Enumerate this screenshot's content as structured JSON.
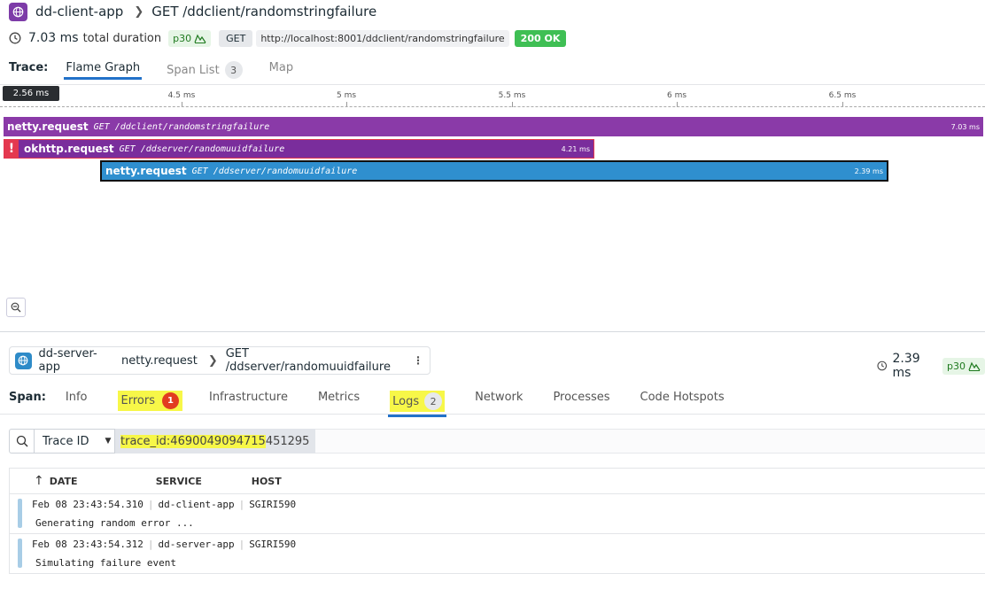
{
  "header": {
    "app_name": "dd-client-app",
    "route": "GET /ddclient/randomstringfailure",
    "duration": "7.03 ms",
    "duration_label": "total duration",
    "percentile": "p30",
    "method": "GET",
    "url": "http://localhost:8001/ddclient/randomstringfailure",
    "status": "200 OK"
  },
  "trace_tabs": {
    "label": "Trace:",
    "items": [
      {
        "label": "Flame Graph"
      },
      {
        "label": "Span List",
        "count": "3"
      },
      {
        "label": "Map"
      }
    ]
  },
  "ruler": {
    "cursor": "2.56 ms",
    "ticks": [
      "4.5 ms",
      "5 ms",
      "5.5 ms",
      "6 ms",
      "6.5 ms"
    ]
  },
  "spans": [
    {
      "name": "netty.request",
      "resource": "GET /ddclient/randomstringfailure",
      "duration": "7.03 ms",
      "color": "#8a3aa8"
    },
    {
      "name": "okhttp.request",
      "resource": "GET /ddserver/randomuuidfailure",
      "duration": "4.21 ms",
      "color": "#7a2d9c",
      "error": "!"
    },
    {
      "name": "netty.request",
      "resource": "GET /ddserver/randomuuidfailure",
      "duration": "2.39 ms",
      "color": "#2f8fcf"
    }
  ],
  "span_panel": {
    "service": "dd-server-app",
    "operation": "netty.request",
    "resource": "GET /ddserver/randomuuidfailure",
    "duration": "2.39 ms",
    "percentile": "p30"
  },
  "span_tabs": {
    "label": "Span:",
    "items": [
      {
        "label": "Info"
      },
      {
        "label": "Errors",
        "count": "1"
      },
      {
        "label": "Infrastructure"
      },
      {
        "label": "Metrics"
      },
      {
        "label": "Logs",
        "count": "2"
      },
      {
        "label": "Network"
      },
      {
        "label": "Processes"
      },
      {
        "label": "Code Hotspots"
      }
    ]
  },
  "log_search": {
    "facet": "Trace ID",
    "query_highlight": "trace_id:4690049094715",
    "query_rest": "451295"
  },
  "logs": {
    "columns": [
      "DATE",
      "SERVICE",
      "HOST"
    ],
    "rows": [
      {
        "date": "Feb 08 23:43:54.310",
        "service": "dd-client-app",
        "host": "SGIRI590",
        "message": "Generating random error ..."
      },
      {
        "date": "Feb 08 23:43:54.312",
        "service": "dd-server-app",
        "host": "SGIRI590",
        "message": "Simulating failure event"
      }
    ]
  },
  "colors": {
    "accent": "#2372c9",
    "highlight": "#f7f748",
    "error": "#e4384f"
  }
}
